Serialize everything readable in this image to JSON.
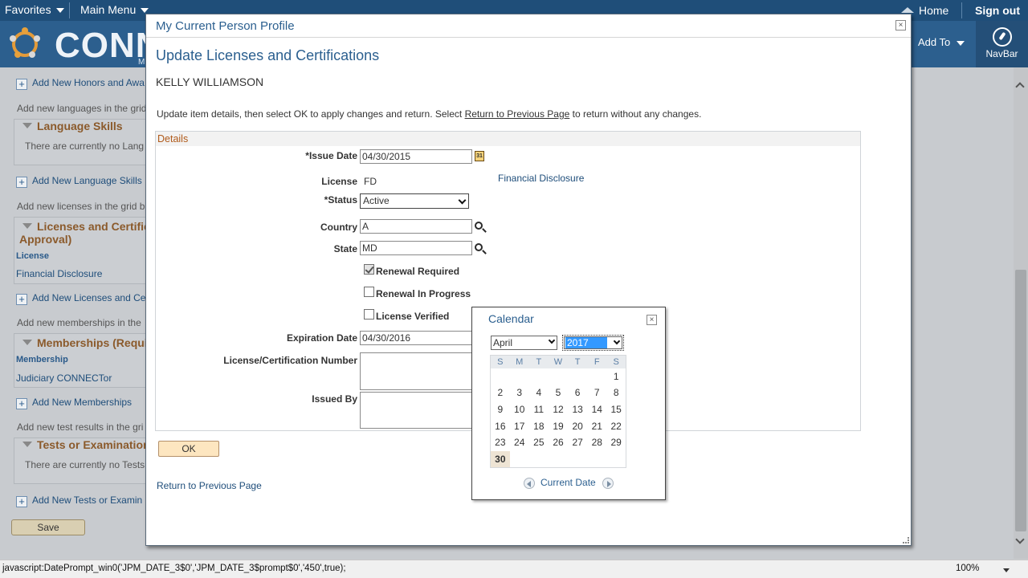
{
  "topbar": {
    "favorites_label": "Favorites",
    "main_menu_label": "Main Menu",
    "home_label": "Home",
    "signout_label": "Sign out",
    "brand_text": "CONN",
    "brand_sub": "M",
    "add_to_label": "Add To",
    "navbar_label": "NavBar"
  },
  "background_page": {
    "honors_add_link": "Add New Honors and Awa",
    "languages_info": "Add new languages in the grid",
    "language_section_title": "Language Skills",
    "language_empty": "There are currently no Lang",
    "language_add_link": "Add New Language Skills",
    "licenses_info": "Add new licenses in the grid b",
    "licenses_section_title_line1": "Licenses and Certific",
    "licenses_section_title_line2": "Approval)",
    "licenses_col_header": "License",
    "licenses_row": "Financial Disclosure",
    "licenses_add_link": "Add New Licenses and Ce",
    "memberships_info": "Add new memberships in the",
    "memberships_section_title": "Memberships (Requir",
    "memberships_col_header": "Membership",
    "memberships_row": "Judiciary CONNECTor",
    "memberships_add_link": "Add New Memberships",
    "tests_info": "Add new test results in the gri",
    "tests_section_title": "Tests or Examination",
    "tests_empty": "There are currently no Tests",
    "tests_add_link": "Add New Tests or Examin",
    "save_label": "Save"
  },
  "modal": {
    "title": "My Current Person Profile",
    "close_label": "×",
    "page_title": "Update Licenses and Certifications",
    "person_name": "KELLY WILLIAMSON",
    "instructions_before": "Update item details, then select OK to apply changes and return. Select ",
    "instructions_link": "Return to Previous Page",
    "instructions_after": " to return without any changes.",
    "details_header": "Details",
    "fields": {
      "issue_date_label": "*Issue Date",
      "issue_date_value": "04/30/2015",
      "license_label": "License",
      "license_value": "FD",
      "license_desc": "Financial Disclosure",
      "status_label": "*Status",
      "status_value": "Active",
      "country_label": "Country",
      "country_value": "A",
      "state_label": "State",
      "state_value": "MD",
      "renewal_required_label": "Renewal Required",
      "renewal_required_checked": true,
      "renewal_in_progress_label": "Renewal In Progress",
      "renewal_in_progress_checked": false,
      "license_verified_label": "License Verified",
      "license_verified_checked": false,
      "expiration_date_label": "Expiration Date",
      "expiration_date_value": "04/30/2016",
      "cert_number_label": "License/Certification Number",
      "issued_by_label": "Issued By"
    },
    "ok_label": "OK",
    "return_link": "Return to Previous Page"
  },
  "calendar": {
    "title": "Calendar",
    "close_label": "×",
    "month": "April",
    "year": "2017",
    "weekdays": [
      "S",
      "M",
      "T",
      "W",
      "T",
      "F",
      "S"
    ],
    "weeks": [
      [
        "",
        "",
        "",
        "",
        "",
        "",
        "1"
      ],
      [
        "2",
        "3",
        "4",
        "5",
        "6",
        "7",
        "8"
      ],
      [
        "9",
        "10",
        "11",
        "12",
        "13",
        "14",
        "15"
      ],
      [
        "16",
        "17",
        "18",
        "19",
        "20",
        "21",
        "22"
      ],
      [
        "23",
        "24",
        "25",
        "26",
        "27",
        "28",
        "29"
      ],
      [
        "30",
        "",
        "",
        "",
        "",
        "",
        ""
      ]
    ],
    "today": "30",
    "current_date_label": "Current Date"
  },
  "statusbar": {
    "url_text": "javascript:DatePrompt_win0('JPM_DATE_3$0','JPM_DATE_3$prompt$0','450',true);",
    "zoom": "100%"
  },
  "colors": {
    "header_blue": "#1f4e79",
    "title_blue": "#2b5f8f",
    "section_orange": "#b05a1a",
    "ok_button": "#fde6c0"
  }
}
